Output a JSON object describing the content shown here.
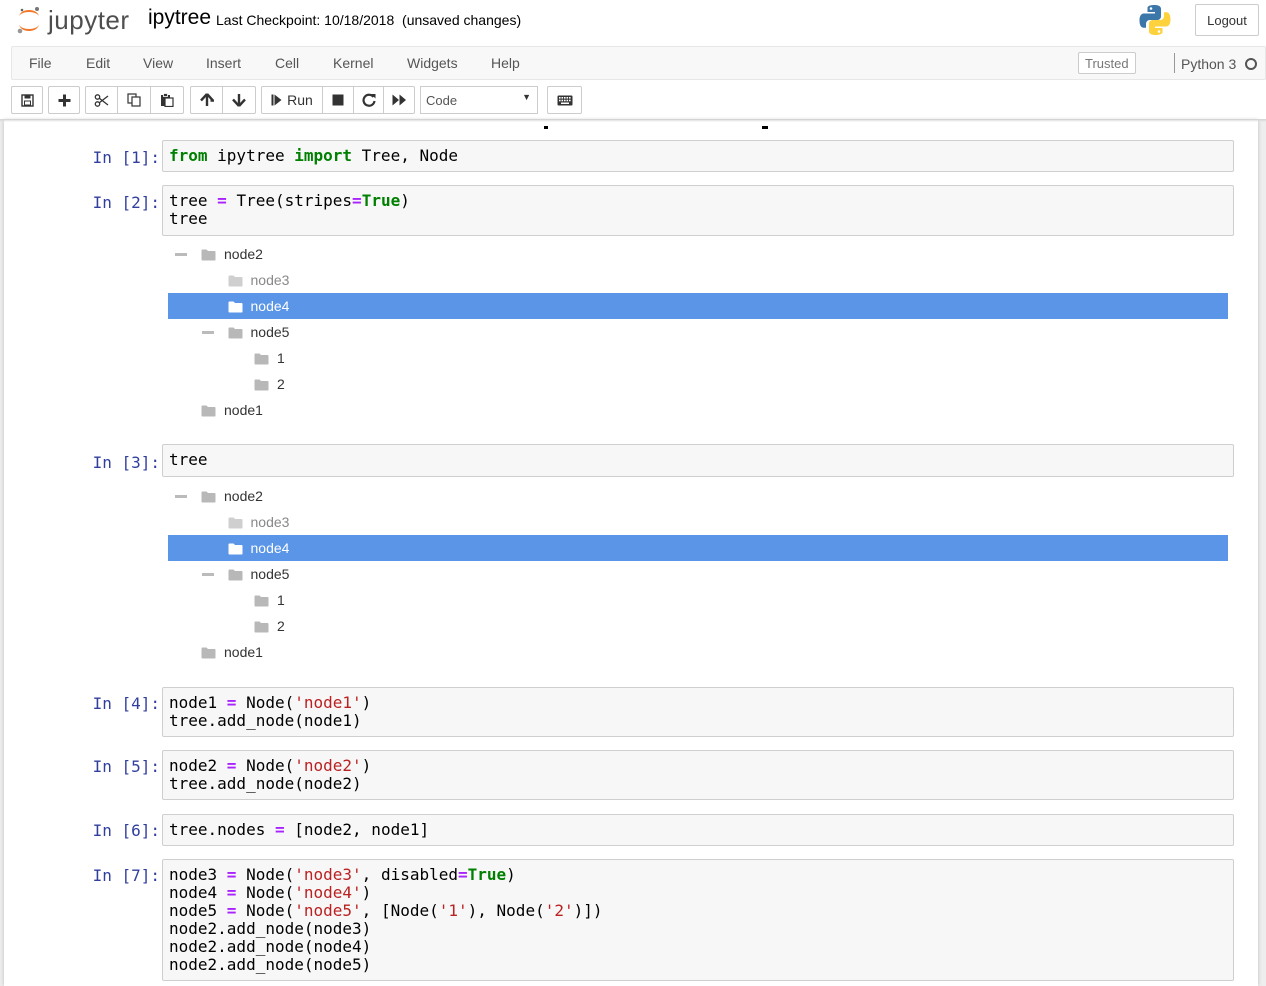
{
  "header": {
    "logo_text": "jupyter",
    "notebook_title": "ipytree",
    "checkpoint": "Last Checkpoint: 10/18/2018",
    "unsaved": "(unsaved changes)",
    "logout_label": "Logout"
  },
  "menubar": {
    "items": [
      "File",
      "Edit",
      "View",
      "Insert",
      "Cell",
      "Kernel",
      "Widgets",
      "Help"
    ],
    "trusted_label": "Trusted",
    "kernel_name": "Python 3"
  },
  "toolbar": {
    "run_label": "Run",
    "cell_type": "Code",
    "icons": [
      "save-icon",
      "plus-icon",
      "cut-icon",
      "copy-icon",
      "paste-icon",
      "arrow-up-icon",
      "arrow-down-icon",
      "step-forward-icon",
      "stop-icon",
      "restart-icon",
      "fast-forward-icon",
      "keyboard-icon"
    ]
  },
  "colors": {
    "prompt": "#303f9f",
    "selected_row": "#5a95e8",
    "keyword": "#008000",
    "operator": "#aa22ff",
    "string": "#ba2121"
  },
  "cells": [
    {
      "prompt": "In [1]:"
    },
    {
      "prompt": "In [2]:"
    },
    {
      "prompt": "In [3]:"
    },
    {
      "prompt": "In [4]:"
    },
    {
      "prompt": "In [5]:"
    },
    {
      "prompt": "In [6]:"
    },
    {
      "prompt": "In [7]:"
    }
  ],
  "code": {
    "c1": {
      "from": "from",
      "mod": " ipytree ",
      "import": "import",
      "rest": " Tree, Node"
    },
    "c2": {
      "l1a": "tree ",
      "eq": "=",
      "l1b": " Tree(stripes",
      "eq2": "=",
      "true": "True",
      "l1c": ")",
      "l2": "tree"
    },
    "c3": {
      "l1": "tree"
    },
    "c4": {
      "a": "node1 ",
      "eq": "=",
      "b": " Node(",
      "s": "'node1'",
      "c": ")",
      "l2": "tree.add_node(node1)"
    },
    "c5": {
      "a": "node2 ",
      "eq": "=",
      "b": " Node(",
      "s": "'node2'",
      "c": ")",
      "l2": "tree.add_node(node2)"
    },
    "c6": {
      "a": "tree.nodes ",
      "eq": "=",
      "b": " [node2, node1]"
    },
    "c7": {
      "l1a": "node3 ",
      "l1eq": "=",
      "l1b": " Node(",
      "l1s": "'node3'",
      "l1c": ", disabled",
      "l1eq2": "=",
      "l1t": "True",
      "l1d": ")",
      "l2a": "node4 ",
      "l2eq": "=",
      "l2b": " Node(",
      "l2s": "'node4'",
      "l2c": ")",
      "l3a": "node5 ",
      "l3eq": "=",
      "l3b": " Node(",
      "l3s": "'node5'",
      "l3c": ", [Node(",
      "l3s2": "'1'",
      "l3d": "), Node(",
      "l3s3": "'2'",
      "l3e": ")])",
      "l4": "node2.add_node(node3)",
      "l5": "node2.add_node(node4)",
      "l6": "node2.add_node(node5)"
    }
  },
  "tree_output": {
    "rows": [
      {
        "label": "node2",
        "depth": 0,
        "toggle": true,
        "state": "normal"
      },
      {
        "label": "node3",
        "depth": 1,
        "toggle": false,
        "state": "disabled"
      },
      {
        "label": "node4",
        "depth": 1,
        "toggle": false,
        "state": "selected"
      },
      {
        "label": "node5",
        "depth": 1,
        "toggle": true,
        "state": "normal"
      },
      {
        "label": "1",
        "depth": 2,
        "toggle": false,
        "state": "normal"
      },
      {
        "label": "2",
        "depth": 2,
        "toggle": false,
        "state": "normal"
      },
      {
        "label": "node1",
        "depth": 0,
        "toggle": false,
        "state": "normal"
      }
    ]
  }
}
